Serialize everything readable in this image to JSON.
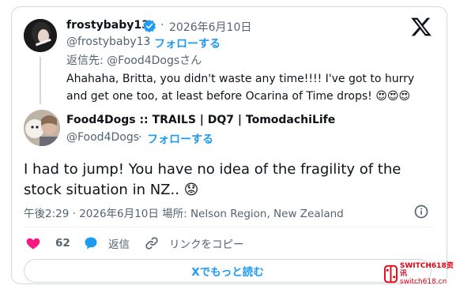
{
  "reply": {
    "display_name": "frostybaby13",
    "verified": true,
    "timestamp": "2026年6月10日",
    "dot": "·",
    "handle": "@frostybaby13",
    "follow_label": "フォローする",
    "replying_to": "返信先: @Food4Dogsさん",
    "text": "Ahahaha, Britta, you didn't waste any time!!!! I've got to hurry and get one too, at least before Ocarina of Time drops! 😍😍😍"
  },
  "main": {
    "display_name": "Food4Dogs :: TRAILS | DQ7 | TomodachiLife",
    "handle": "@Food4Dogs",
    "dot": "·",
    "follow_label": "フォローする",
    "text": "I had to jump! You have no idea of the fragility of the stock situation in NZ.. 😟",
    "meta": "午後2:29 · 2026年6月10日 場所: Nelson Region, New Zealand"
  },
  "actions": {
    "likes": "62",
    "reply_label": "返信",
    "copy_link_label": "リンクをコピー"
  },
  "read_more_label": "Xでもっと読む",
  "watermark": {
    "line1": "SWITCH618资讯",
    "line2": "switch618.cn"
  },
  "colors": {
    "accent": "#1d9bf0",
    "like": "#f91880",
    "text": "#0f1419",
    "muted": "#536471",
    "border": "#cfd9de"
  },
  "icons": [
    "x-logo-icon",
    "verified-badge-icon",
    "heart-icon",
    "reply-bubble-icon",
    "link-icon",
    "info-icon"
  ]
}
